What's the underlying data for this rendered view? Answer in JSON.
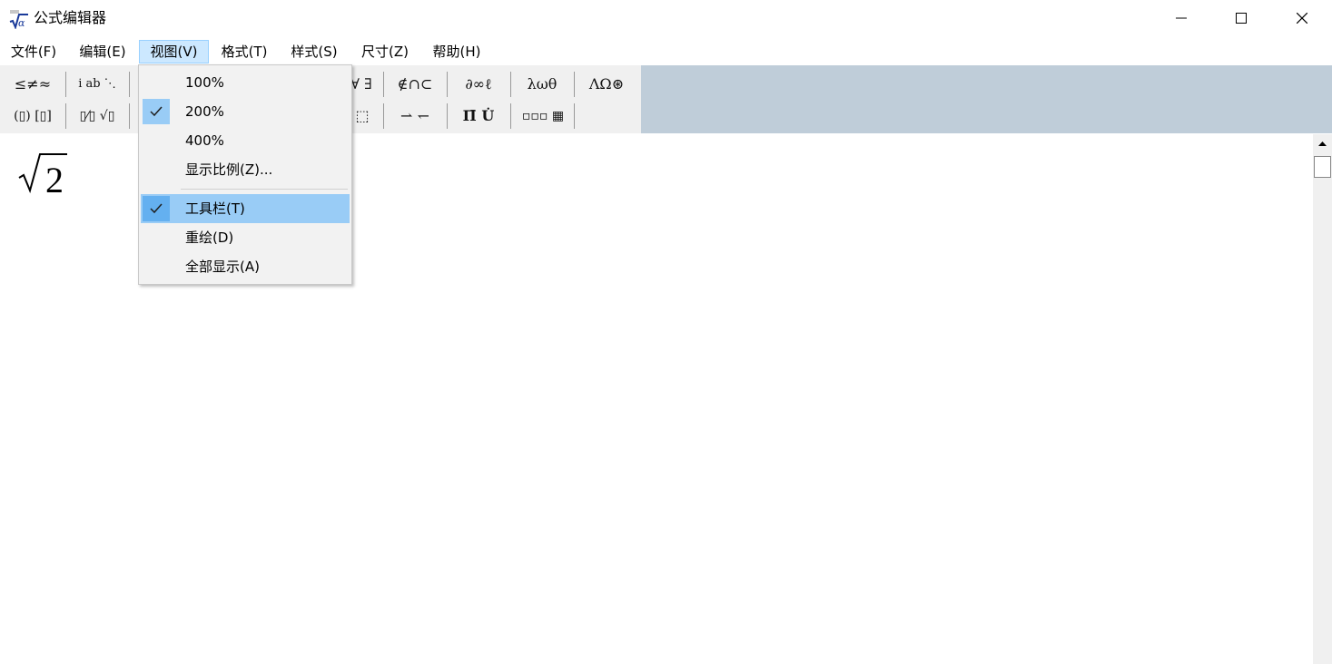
{
  "window": {
    "title": "公式编辑器",
    "icon": "sqrt-alpha-app-icon"
  },
  "menubar": {
    "items": [
      {
        "label": "文件(F)"
      },
      {
        "label": "编辑(E)"
      },
      {
        "label": "视图(V)"
      },
      {
        "label": "格式(T)"
      },
      {
        "label": "样式(S)"
      },
      {
        "label": "尺寸(Z)"
      },
      {
        "label": "帮助(H)"
      }
    ],
    "active_index": 2
  },
  "toolbar": {
    "row1": [
      {
        "glyph": "≤≠≈"
      },
      {
        "glyph": "ⅰ ab ⋱"
      },
      {
        "glyph": "∀ ∃"
      },
      {
        "glyph": "∉∩⊂"
      },
      {
        "glyph": "∂∞ℓ"
      },
      {
        "glyph": "λωθ"
      },
      {
        "glyph": "ΛΩ⊛"
      }
    ],
    "row2": [
      {
        "glyph": "(▯) [▯]"
      },
      {
        "glyph": "▯⁄▯ √▯"
      },
      {
        "glyph": "⬚"
      },
      {
        "glyph": "⇀ ↽"
      },
      {
        "glyph": "Π̄ U̇"
      },
      {
        "glyph": "▫▫▫ ▦"
      }
    ]
  },
  "formula": {
    "radicand": "2",
    "radical": "√"
  },
  "view_menu": {
    "items": [
      {
        "label": "100%",
        "checked": false
      },
      {
        "label": "200%",
        "checked": true
      },
      {
        "label": "400%",
        "checked": false
      },
      {
        "label": "显示比例(Z)...",
        "checked": false
      },
      {
        "label": "工具栏(T)",
        "checked": true,
        "highlighted": true
      },
      {
        "label": "重绘(D)",
        "checked": false
      },
      {
        "label": "全部显示(A)",
        "checked": false
      }
    ]
  },
  "colors": {
    "menu_highlight": "#99ccf6",
    "toolbar_bg": "#f0f0f0",
    "toolbar_empty_bg": "#bfcdd9",
    "active_menu_bg": "#cce8ff"
  }
}
